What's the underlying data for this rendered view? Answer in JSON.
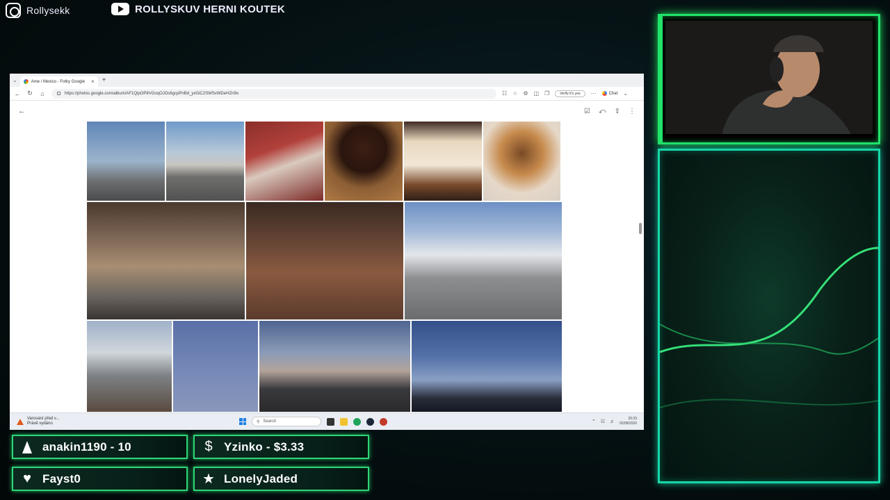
{
  "overlay": {
    "instagram": {
      "handle": "Rollysekk",
      "icon": "instagram-icon"
    },
    "youtube": {
      "channel": "ROLLYSKUV HERNI KOUTEK",
      "icon": "youtube-icon"
    }
  },
  "browser": {
    "tab_title": "Ame / Mexico - Fotky Google",
    "url": "https://photos.google.com/album/AF1QipOP8VGoqOJOs6gcpPnBd_yxGiC2SWSvWDeHZn9o",
    "verify_label": "Verify it's you",
    "chat_label": "Chat"
  },
  "photos": {
    "rows": [
      [
        {
          "name": "photo-motel-sign",
          "w": 112,
          "bg": "linear-gradient(180deg,#5f86b8 0%,#9cb4cc 50%,#6e6f70 75%,#4b4c4d 100%)"
        },
        {
          "name": "photo-walmart-building",
          "w": 112,
          "bg": "linear-gradient(180deg,#6f9ac9 0%,#b9c9d8 40%,#c6c4be 55%,#6e6e6c 70%,#525252 100%)"
        },
        {
          "name": "photo-diner-booth",
          "w": 112,
          "bg": "linear-gradient(160deg,#8b2f2a 0%,#b1403a 35%,#d9c9be 55%,#7c2b27 100%)"
        },
        {
          "name": "photo-soda-glass",
          "w": 112,
          "bg": "radial-gradient(circle at 50% 35%,#3b1f14 0%,#2a150e 35%,#8c5e34 60%,#b07a44 100%)"
        },
        {
          "name": "photo-menu",
          "w": 112,
          "bg": "linear-gradient(180deg,#3f2a22 0%,#e8d8c0 25%,#f2e7d6 55%,#7a4a2a 80%,#2d1f18 100%)"
        },
        {
          "name": "photo-burger-onion-rings",
          "w": 111,
          "bg": "radial-gradient(circle at 50% 40%,#7a4a26 0%,#c68a4c 35%,#e6d8c8 65%,#d8d0c6 100%)"
        }
      ],
      [
        {
          "name": "photo-diner-counter",
          "w": 227,
          "bg": "linear-gradient(180deg,#4a3a2e 0%,#7d6656 30%,#a88e72 55%,#6b6560 80%,#3a3532 100%)"
        },
        {
          "name": "photo-dennys-sign",
          "w": 226,
          "bg": "linear-gradient(180deg,#3a2a22 0%,#6e4a38 40%,#8a5a40 60%,#5a3a2c 100%)"
        },
        {
          "name": "photo-trucks-lot",
          "w": 226,
          "bg": "linear-gradient(180deg,#6d90c4 0%,#a2b9d8 25%,#e4e6ea 45%,#8c8e90 65%,#6a6c6e 100%)"
        }
      ],
      [
        {
          "name": "photo-selfie-truck",
          "w": 122,
          "bg": "linear-gradient(180deg,#9fb2c8 0%,#d0d6dc 35%,#7e8286 60%,#5a4a40 100%)"
        },
        {
          "name": "photo-us-flag-sky",
          "w": 122,
          "bg": "linear-gradient(180deg,#5a6fa6 0%,#7387b7 50%,#8a97bb 100%)"
        },
        {
          "name": "photo-cybertruck",
          "w": 217,
          "bg": "linear-gradient(180deg,#4e6590 0%,#8b9bb8 35%,#b3a39a 55%,#3a3a3e 75%,#2a2a2c 100%)"
        },
        {
          "name": "photo-dusk-skyline",
          "w": 216,
          "bg": "linear-gradient(180deg,#34508a 0%,#5572a8 40%,#8aa0c4 65%,#2a2e3c 85%,#141820 100%)"
        }
      ]
    ]
  },
  "taskbar": {
    "warning_title": "Varování před v...",
    "warning_sub": "Právě vydáno",
    "search_placeholder": "Search",
    "time": "20:33",
    "date": "02/08/2026"
  },
  "alerts": [
    {
      "icon": "diamond-icon",
      "label": "anakin1190 - 10"
    },
    {
      "icon": "dollar-icon",
      "label": "Yzinko - $3.33"
    },
    {
      "icon": "heart-icon",
      "label": "Fayst0"
    },
    {
      "icon": "star-icon",
      "label": "LonelyJaded"
    }
  ],
  "colors": {
    "accent_green": "#22e36a",
    "panel_teal": "#17d6a8",
    "warning_orange": "#e05a1a"
  }
}
